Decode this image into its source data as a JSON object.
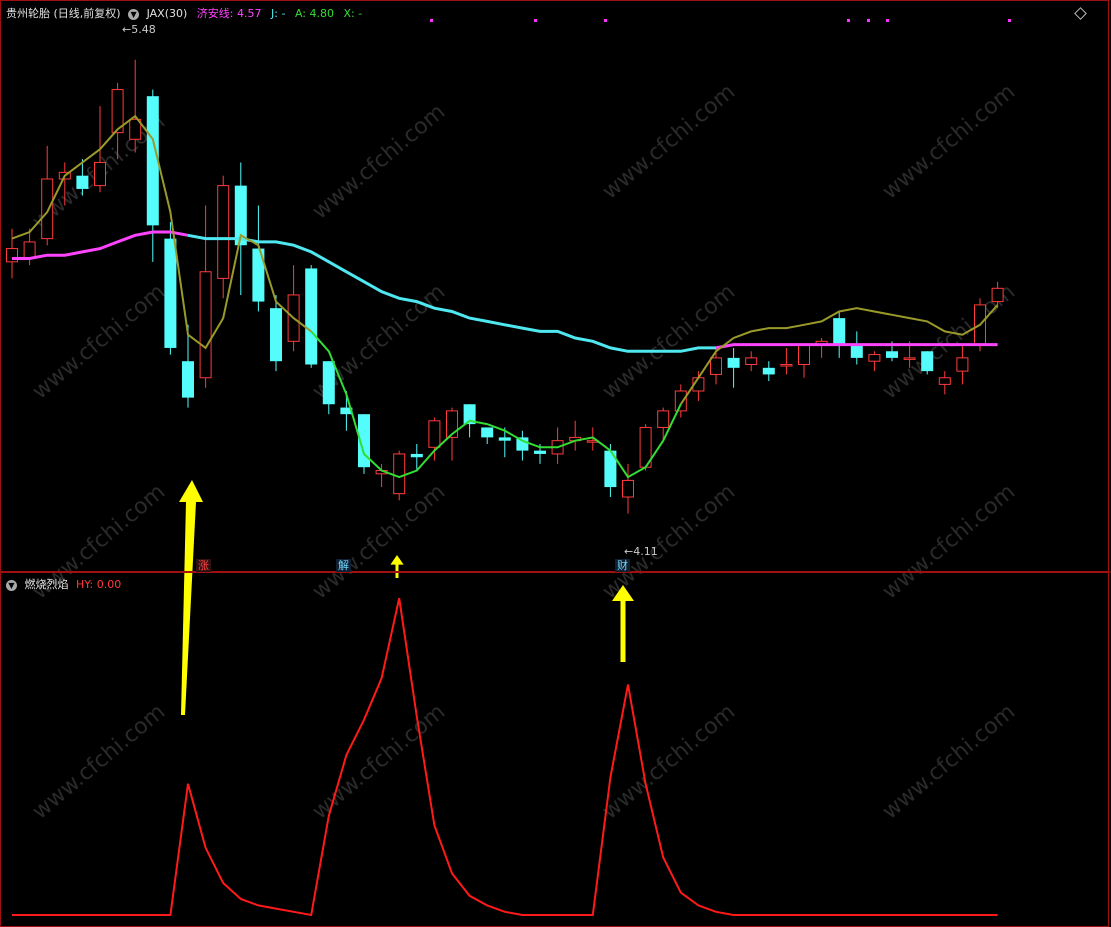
{
  "header": {
    "stock_name": "贵州轮胎",
    "period": "(日线,前复权)",
    "indicator_name": "JAX(30)",
    "jian_label": "济安线:",
    "jian_value": "4.57",
    "j_label": "J:",
    "j_value": "-",
    "a_label": "A:",
    "a_value": "4.80",
    "x_label": "X:",
    "x_value": "-"
  },
  "sub_header": {
    "name": "燃烧烈焰",
    "hy_label": "HY:",
    "hy_value": "0.00"
  },
  "annotations": {
    "high_price": "5.48",
    "low_price": "4.11",
    "marker_zhang": "涨",
    "marker_jie": "解",
    "marker_cai": "财"
  },
  "colors": {
    "up": "#ff3b3b",
    "down": "#54fcfc",
    "jian_line": "#ff44ff",
    "a_line": "#4fe8f0",
    "j_line_green": "#33dd33",
    "j_line_olive": "#9a9a2a",
    "hy_line": "#ff1a1a",
    "arrow": "#ffff00",
    "divider": "#a01010"
  },
  "chart_data": [
    {
      "type": "candlestick",
      "title": "贵州轮胎 (日线,前复权)",
      "ylim": [
        4.0,
        5.6
      ],
      "candles": [
        {
          "o": 4.87,
          "h": 4.97,
          "l": 4.82,
          "c": 4.91
        },
        {
          "o": 4.88,
          "h": 4.97,
          "l": 4.86,
          "c": 4.93
        },
        {
          "o": 4.94,
          "h": 5.22,
          "l": 4.92,
          "c": 5.12
        },
        {
          "o": 5.12,
          "h": 5.17,
          "l": 5.04,
          "c": 5.14
        },
        {
          "o": 5.13,
          "h": 5.18,
          "l": 5.07,
          "c": 5.09
        },
        {
          "o": 5.1,
          "h": 5.34,
          "l": 5.08,
          "c": 5.17
        },
        {
          "o": 5.26,
          "h": 5.41,
          "l": 5.18,
          "c": 5.39
        },
        {
          "o": 5.24,
          "h": 5.48,
          "l": 5.2,
          "c": 5.3
        },
        {
          "o": 5.37,
          "h": 5.39,
          "l": 4.87,
          "c": 4.98
        },
        {
          "o": 4.94,
          "h": 4.99,
          "l": 4.59,
          "c": 4.61
        },
        {
          "o": 4.57,
          "h": 4.68,
          "l": 4.43,
          "c": 4.46
        },
        {
          "o": 4.52,
          "h": 5.04,
          "l": 4.49,
          "c": 4.84
        },
        {
          "o": 4.82,
          "h": 5.13,
          "l": 4.76,
          "c": 5.1
        },
        {
          "o": 5.1,
          "h": 5.17,
          "l": 4.77,
          "c": 4.92
        },
        {
          "o": 4.91,
          "h": 5.04,
          "l": 4.72,
          "c": 4.75
        },
        {
          "o": 4.73,
          "h": 4.77,
          "l": 4.54,
          "c": 4.57
        },
        {
          "o": 4.63,
          "h": 4.86,
          "l": 4.6,
          "c": 4.77
        },
        {
          "o": 4.85,
          "h": 4.86,
          "l": 4.55,
          "c": 4.56
        },
        {
          "o": 4.57,
          "h": 4.57,
          "l": 4.41,
          "c": 4.44
        },
        {
          "o": 4.43,
          "h": 4.48,
          "l": 4.36,
          "c": 4.41
        },
        {
          "o": 4.41,
          "h": 4.41,
          "l": 4.23,
          "c": 4.25
        },
        {
          "o": 4.23,
          "h": 4.26,
          "l": 4.19,
          "c": 4.24
        },
        {
          "o": 4.17,
          "h": 4.3,
          "l": 4.15,
          "c": 4.29
        },
        {
          "o": 4.29,
          "h": 4.32,
          "l": 4.24,
          "c": 4.28
        },
        {
          "o": 4.31,
          "h": 4.4,
          "l": 4.27,
          "c": 4.39
        },
        {
          "o": 4.34,
          "h": 4.43,
          "l": 4.27,
          "c": 4.42
        },
        {
          "o": 4.44,
          "h": 4.44,
          "l": 4.34,
          "c": 4.38
        },
        {
          "o": 4.37,
          "h": 4.37,
          "l": 4.32,
          "c": 4.34
        },
        {
          "o": 4.34,
          "h": 4.37,
          "l": 4.28,
          "c": 4.33
        },
        {
          "o": 4.34,
          "h": 4.36,
          "l": 4.27,
          "c": 4.3
        },
        {
          "o": 4.3,
          "h": 4.32,
          "l": 4.26,
          "c": 4.29
        },
        {
          "o": 4.29,
          "h": 4.37,
          "l": 4.26,
          "c": 4.33
        },
        {
          "o": 4.33,
          "h": 4.39,
          "l": 4.3,
          "c": 4.34
        },
        {
          "o": 4.33,
          "h": 4.37,
          "l": 4.3,
          "c": 4.33
        },
        {
          "o": 4.3,
          "h": 4.32,
          "l": 4.16,
          "c": 4.19
        },
        {
          "o": 4.16,
          "h": 4.26,
          "l": 4.11,
          "c": 4.21
        },
        {
          "o": 4.25,
          "h": 4.38,
          "l": 4.24,
          "c": 4.37
        },
        {
          "o": 4.37,
          "h": 4.43,
          "l": 4.33,
          "c": 4.42
        },
        {
          "o": 4.42,
          "h": 4.5,
          "l": 4.4,
          "c": 4.48
        },
        {
          "o": 4.48,
          "h": 4.54,
          "l": 4.45,
          "c": 4.52
        },
        {
          "o": 4.53,
          "h": 4.61,
          "l": 4.5,
          "c": 4.58
        },
        {
          "o": 4.58,
          "h": 4.61,
          "l": 4.49,
          "c": 4.55
        },
        {
          "o": 4.56,
          "h": 4.6,
          "l": 4.54,
          "c": 4.58
        },
        {
          "o": 4.55,
          "h": 4.57,
          "l": 4.51,
          "c": 4.53
        },
        {
          "o": 4.56,
          "h": 4.61,
          "l": 4.53,
          "c": 4.56
        },
        {
          "o": 4.56,
          "h": 4.62,
          "l": 4.52,
          "c": 4.62
        },
        {
          "o": 4.62,
          "h": 4.64,
          "l": 4.58,
          "c": 4.63
        },
        {
          "o": 4.7,
          "h": 4.72,
          "l": 4.58,
          "c": 4.62
        },
        {
          "o": 4.62,
          "h": 4.66,
          "l": 4.56,
          "c": 4.58
        },
        {
          "o": 4.57,
          "h": 4.6,
          "l": 4.54,
          "c": 4.59
        },
        {
          "o": 4.6,
          "h": 4.63,
          "l": 4.57,
          "c": 4.58
        },
        {
          "o": 4.58,
          "h": 4.63,
          "l": 4.55,
          "c": 4.58
        },
        {
          "o": 4.6,
          "h": 4.6,
          "l": 4.53,
          "c": 4.54
        },
        {
          "o": 4.5,
          "h": 4.54,
          "l": 4.47,
          "c": 4.52
        },
        {
          "o": 4.54,
          "h": 4.62,
          "l": 4.5,
          "c": 4.58
        },
        {
          "o": 4.62,
          "h": 4.76,
          "l": 4.6,
          "c": 4.74
        },
        {
          "o": 4.75,
          "h": 4.81,
          "l": 4.73,
          "c": 4.79
        }
      ],
      "series": [
        {
          "name": "济安线",
          "values": [
            4.88,
            4.88,
            4.89,
            4.89,
            4.9,
            4.91,
            4.93,
            4.95,
            4.96,
            4.96,
            4.95,
            4.94,
            4.94,
            4.94,
            4.93,
            4.93,
            4.92,
            4.9,
            4.87,
            4.84,
            4.81,
            4.78,
            4.76,
            4.75,
            4.73,
            4.72,
            4.7,
            4.69,
            4.68,
            4.67,
            4.66,
            4.66,
            4.64,
            4.63,
            4.61,
            4.6,
            4.6,
            4.6,
            4.6,
            4.61,
            4.61,
            4.62,
            4.62,
            4.62,
            4.62,
            4.62,
            4.62,
            4.62,
            4.62,
            4.62,
            4.62,
            4.62,
            4.62,
            4.62,
            4.62,
            4.62,
            4.62
          ]
        },
        {
          "name": "J",
          "values": [
            4.94,
            4.96,
            5.02,
            5.13,
            5.17,
            5.21,
            5.27,
            5.31,
            5.24,
            5.02,
            4.65,
            4.61,
            4.7,
            4.95,
            4.92,
            4.75,
            4.7,
            4.66,
            4.6,
            4.47,
            4.29,
            4.24,
            4.22,
            4.24,
            4.3,
            4.35,
            4.39,
            4.38,
            4.36,
            4.33,
            4.31,
            4.31,
            4.33,
            4.34,
            4.3,
            4.22,
            4.25,
            4.33,
            4.44,
            4.52,
            4.6,
            4.64,
            4.66,
            4.67,
            4.67,
            4.68,
            4.69,
            4.72,
            4.73,
            4.72,
            4.71,
            4.7,
            4.69,
            4.66,
            4.65,
            4.68,
            4.74
          ]
        },
        {
          "name": "HY",
          "values": [
            0.0,
            0.0,
            0.0,
            0.0,
            0.0,
            0.0,
            0.0,
            0.0,
            0.0,
            0.0,
            0.41,
            0.21,
            0.1,
            0.05,
            0.03,
            0.02,
            0.01,
            0.0,
            0.31,
            0.5,
            0.61,
            0.74,
            0.99,
            0.62,
            0.28,
            0.13,
            0.06,
            0.03,
            0.01,
            0.0,
            0.0,
            0.0,
            0.0,
            0.0,
            0.43,
            0.72,
            0.41,
            0.18,
            0.07,
            0.03,
            0.01,
            0.0,
            0.0,
            0.0,
            0.0,
            0.0,
            0.0,
            0.0,
            0.0,
            0.0,
            0.0,
            0.0,
            0.0,
            0.0,
            0.0,
            0.0,
            0.0
          ]
        }
      ]
    }
  ]
}
